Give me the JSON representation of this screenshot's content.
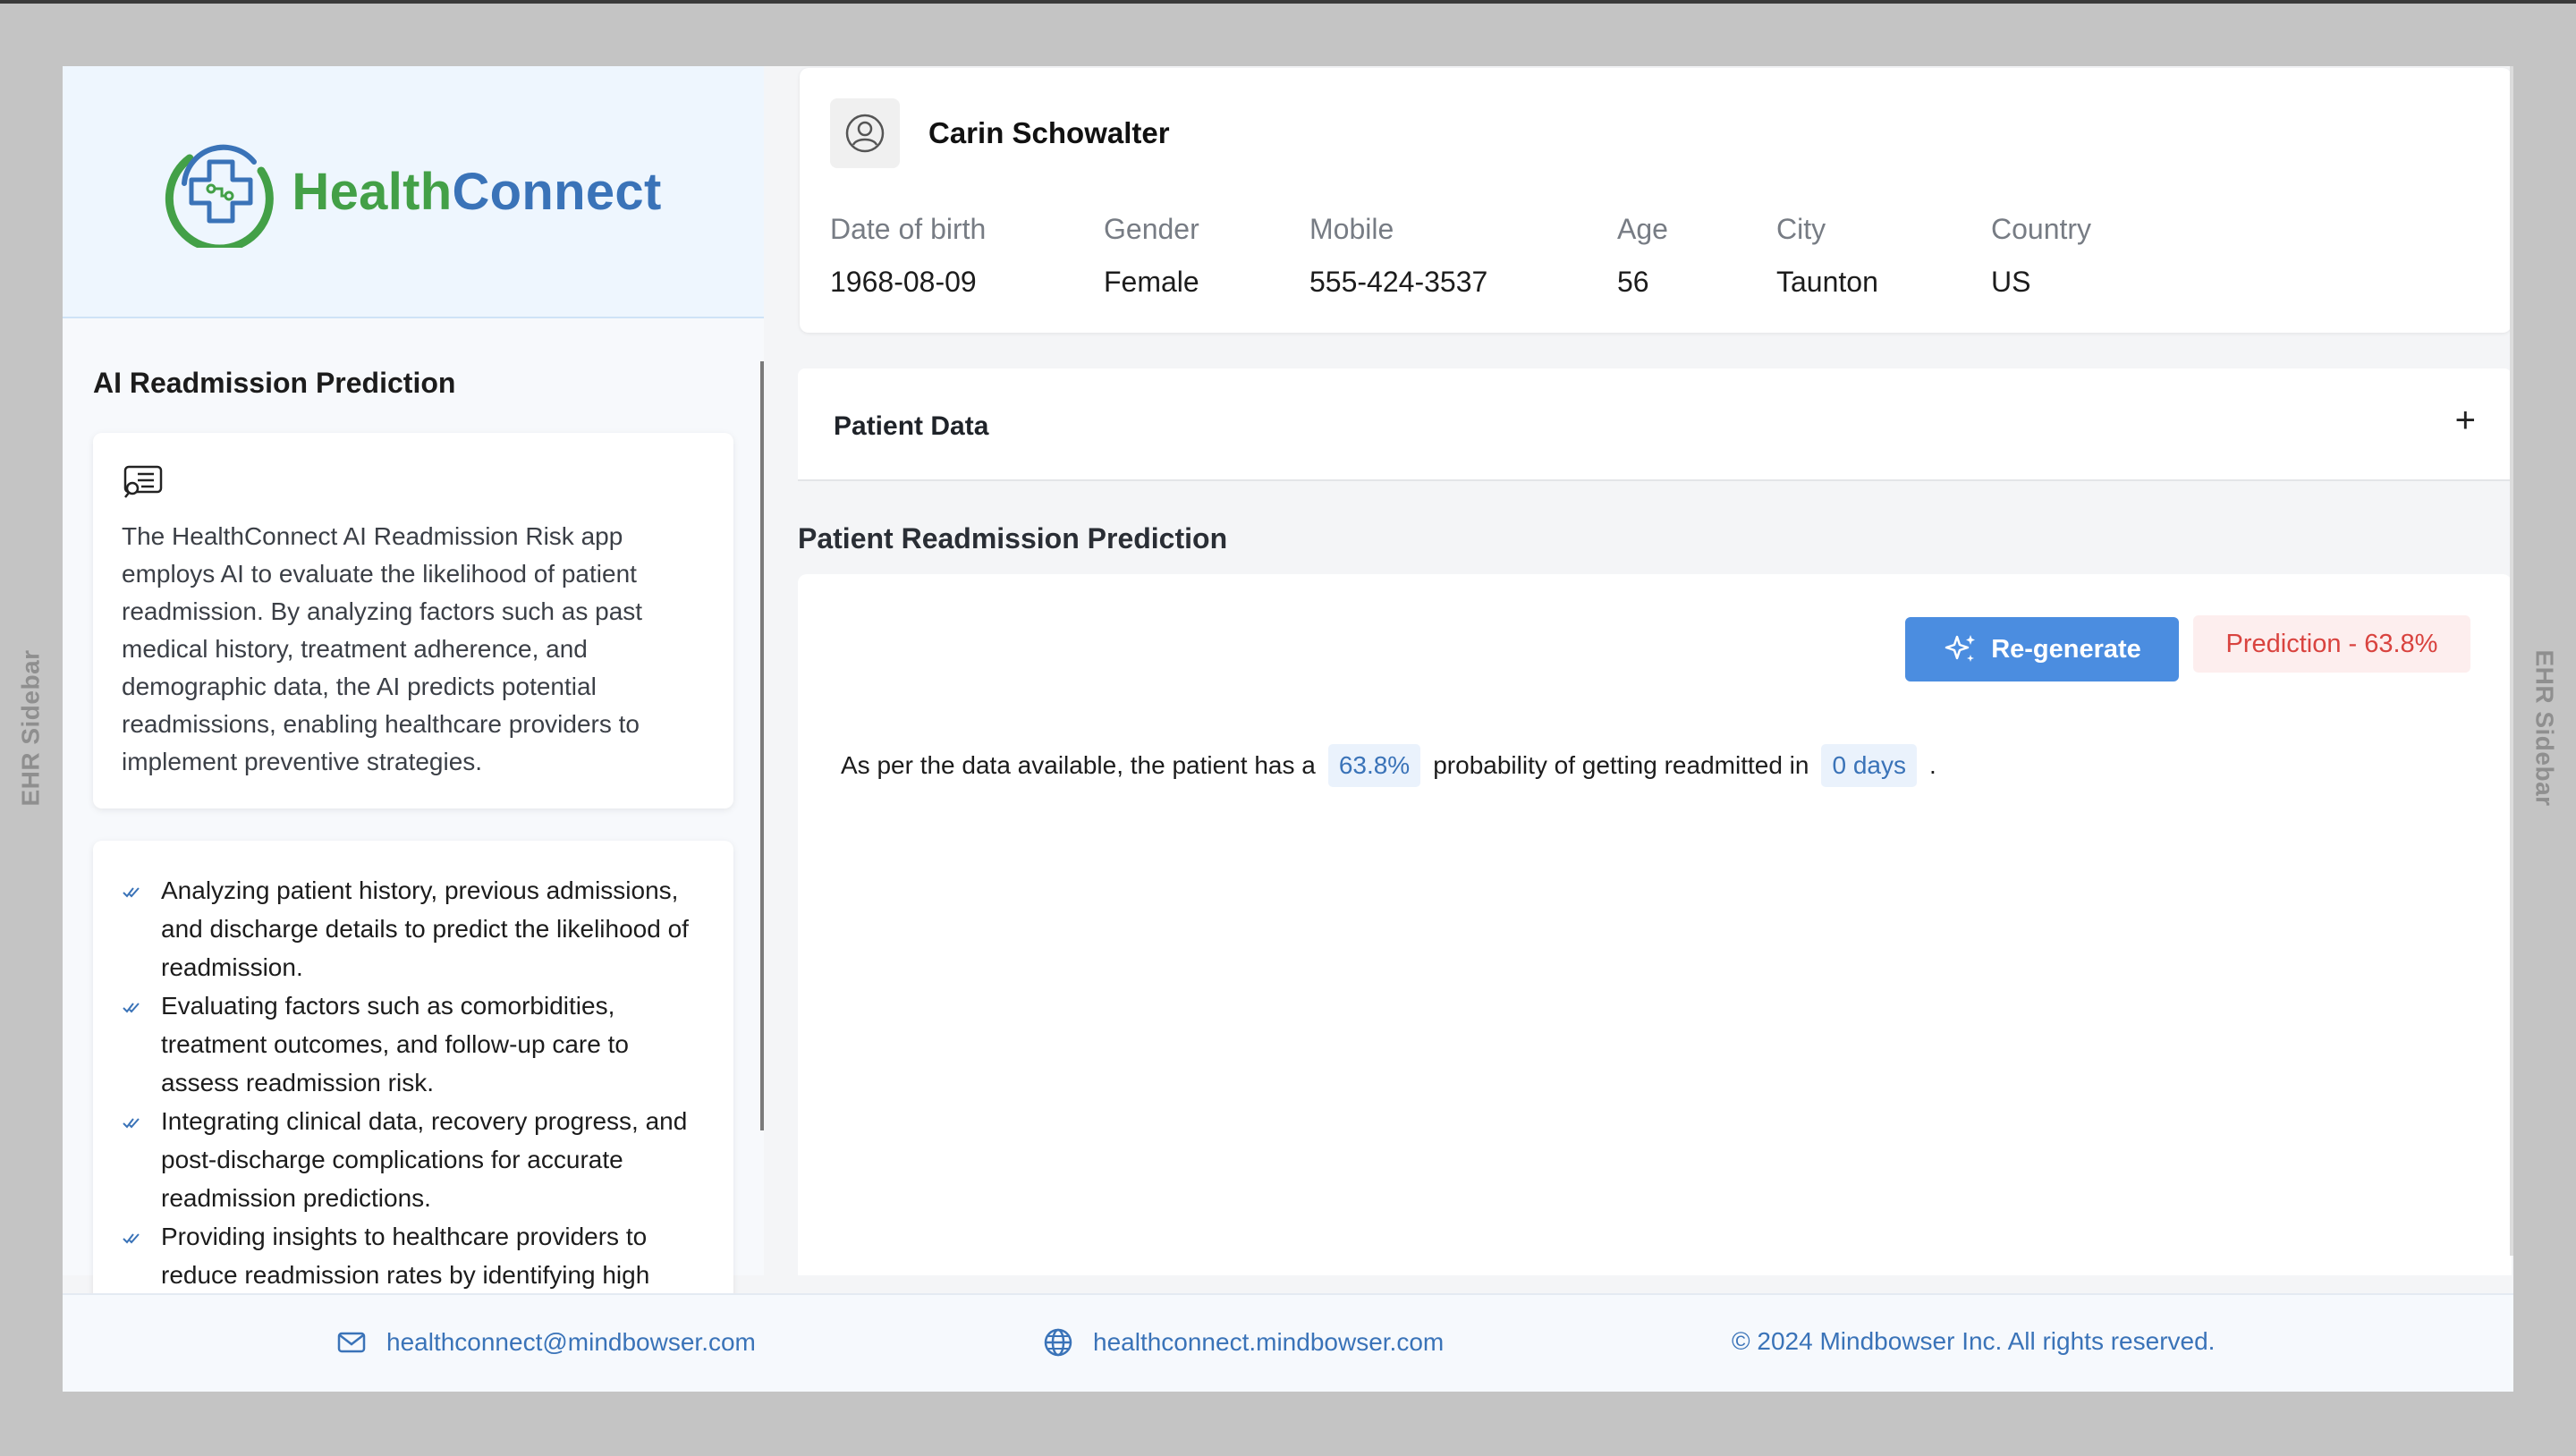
{
  "ehr_sidebar_label": "EHR Sidebar",
  "brand": {
    "name_part1": "Health",
    "name_part2": "Connect",
    "color_green": "#43a047",
    "color_blue": "#3a73b8"
  },
  "sidebar": {
    "title": "AI Readmission Prediction",
    "description": "The HealthConnect AI Readmission Risk app employs AI to evaluate the likelihood of patient readmission. By analyzing factors such as past medical history, treatment adherence, and demographic data, the AI predicts potential readmissions, enabling healthcare providers to implement preventive strategies.",
    "features": [
      "Analyzing patient history, previous admissions, and discharge details to predict the likelihood of readmission.",
      "Evaluating factors such as comorbidities, treatment outcomes, and follow-up care to assess readmission risk.",
      "Integrating clinical data, recovery progress, and post-discharge complications for accurate readmission predictions.",
      "Providing insights to healthcare providers to reduce readmission rates by identifying high"
    ]
  },
  "patient": {
    "name": "Carin Schowalter",
    "fields": [
      {
        "label": "Date of birth",
        "value": "1968-08-09"
      },
      {
        "label": "Gender",
        "value": "Female"
      },
      {
        "label": "Mobile",
        "value": "555-424-3537"
      },
      {
        "label": "Age",
        "value": "56"
      },
      {
        "label": "City",
        "value": "Taunton"
      },
      {
        "label": "Country",
        "value": "US"
      }
    ]
  },
  "accordion": {
    "title": "Patient Data",
    "toggle": "+"
  },
  "prediction": {
    "section_title": "Patient Readmission Prediction",
    "regenerate_label": "Re-generate",
    "badge": "Prediction - 63.8%",
    "sentence_start": "As per the data available, the patient has a",
    "probability": "63.8%",
    "sentence_mid": "probability of getting readmitted in",
    "days": "0 days",
    "sentence_end": ".",
    "accent_color": "#4b8de0",
    "badge_color": "#d9433f"
  },
  "footer": {
    "email": "healthconnect@mindbowser.com",
    "website": "healthconnect.mindbowser.com",
    "copyright": "© 2024 Mindbowser Inc. All rights reserved."
  }
}
